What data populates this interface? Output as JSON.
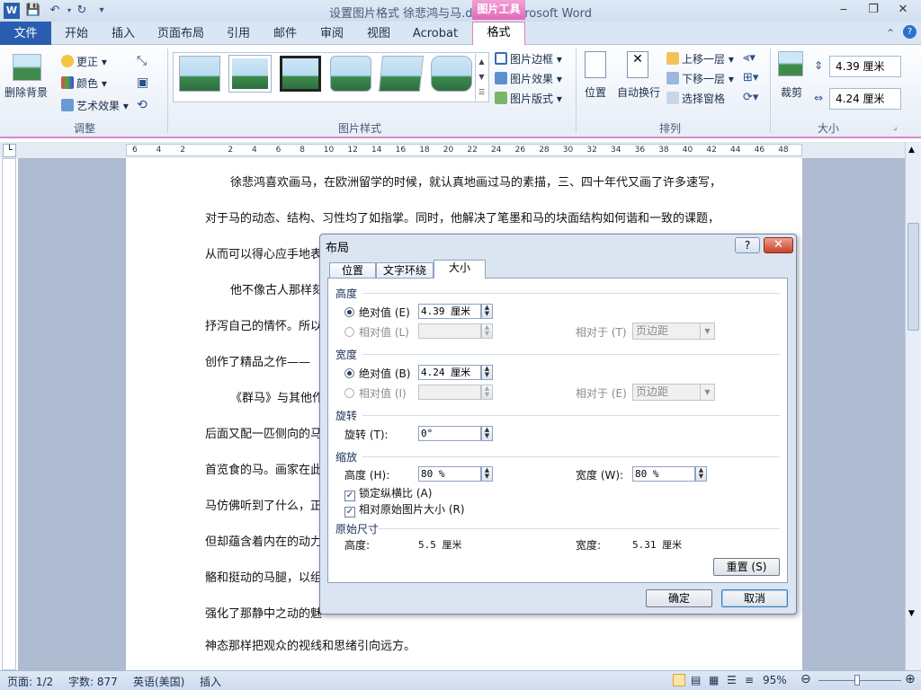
{
  "window": {
    "title": "设置图片格式 徐悲鸿与马.docx - Microsoft Word",
    "context_tab_group": "图片工具"
  },
  "tabs": [
    "文件",
    "开始",
    "插入",
    "页面布局",
    "引用",
    "邮件",
    "审阅",
    "视图",
    "Acrobat",
    "格式"
  ],
  "ribbon": {
    "adjust": {
      "remove_bg": "删除背景",
      "correct": "更正",
      "color": "颜色",
      "art_effect": "艺术效果",
      "label": "调整"
    },
    "styles": {
      "border": "图片边框",
      "effect": "图片效果",
      "layout": "图片版式",
      "label": "图片样式"
    },
    "arrange": {
      "position": "位置",
      "wrap": "自动换行",
      "forward": "上移一层",
      "backward": "下移一层",
      "pane": "选择窗格",
      "label": "排列"
    },
    "size": {
      "crop": "裁剪",
      "height": "4.39 厘米",
      "width": "4.24 厘米",
      "label": "大小"
    }
  },
  "ruler_numbers": [
    "6",
    "4",
    "2",
    "",
    "2",
    "4",
    "6",
    "8",
    "10",
    "12",
    "14",
    "16",
    "18",
    "20",
    "22",
    "24",
    "26",
    "28",
    "30",
    "32",
    "34",
    "36",
    "38",
    "40",
    "42",
    "44",
    "46",
    "48"
  ],
  "document": {
    "lines": [
      "徐悲鸿喜欢画马，在欧洲留学的时候，就认真地画过马的素描，三、四十年代又画了许多速写，",
      "对于马的动态、结构、习性均了如指掌。同时，他解决了笔墨和马的块面结构如何谐和一致的课题，",
      "从而可以得心应手地表",
      "他不像古人那样刻",
      "抒泻自己的情怀。所以",
      "创作了精品之作——",
      "《群马》与其他作",
      "后面又配一匹侧向的马",
      "首览食的马。画家在此",
      "马仿佛听到了什么，正",
      "但却蕴含着内在的动力",
      "骼和挺动的马腿，以组",
      "强化了那静中之动的魅",
      "神态那样把观众的视线和思绪引向远方。"
    ]
  },
  "dialog": {
    "title": "布局",
    "help": "?",
    "close": "✕",
    "tabs": [
      "位置",
      "文字环绕",
      "大小"
    ],
    "height": {
      "section": "高度",
      "absolute": "绝对值 (E)",
      "absolute_value": "4.39 厘米",
      "relative": "相对值 (L)",
      "relative_to": "相对于 (T)",
      "relative_to_value": "页边距"
    },
    "width": {
      "section": "宽度",
      "absolute": "绝对值 (B)",
      "absolute_value": "4.24 厘米",
      "relative": "相对值 (I)",
      "relative_to": "相对于 (E)",
      "relative_to_value": "页边距"
    },
    "rotate": {
      "section": "旋转",
      "label": "旋转 (T):",
      "value": "0°"
    },
    "scale": {
      "section": "缩放",
      "height_label": "高度 (H):",
      "height_value": "80 %",
      "width_label": "宽度 (W):",
      "width_value": "80 %",
      "lock_ratio": "锁定纵横比 (A)",
      "relative_original": "相对原始图片大小 (R)"
    },
    "original": {
      "section": "原始尺寸",
      "height_label": "高度:",
      "height_value": "5.5 厘米",
      "width_label": "宽度:",
      "width_value": "5.31 厘米"
    },
    "reset": "重置 (S)",
    "ok": "确定",
    "cancel": "取消"
  },
  "status": {
    "page": "页面: 1/2",
    "words": "字数: 877",
    "lang": "英语(美国)",
    "mode": "插入",
    "zoom": "95%"
  }
}
